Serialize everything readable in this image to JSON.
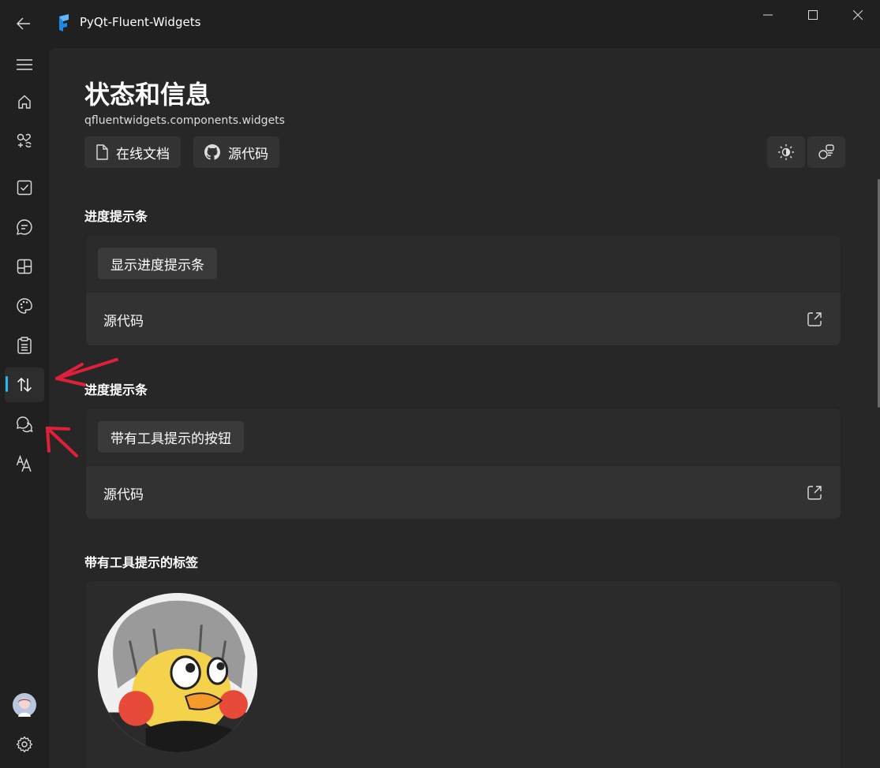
{
  "window": {
    "title": "PyQt-Fluent-Widgets",
    "controls": [
      "minimize-icon",
      "maximize-icon",
      "close-icon"
    ]
  },
  "nav": {
    "items": [
      {
        "name": "menu",
        "icon": "hamburger-icon"
      },
      {
        "name": "home",
        "icon": "home-icon"
      },
      {
        "name": "icons",
        "icon": "shapes-icon"
      },
      {
        "name": "basic-input",
        "icon": "checkbox-icon"
      },
      {
        "name": "dialog-flyout",
        "icon": "chat-bubble-icon"
      },
      {
        "name": "layout",
        "icon": "layout-icon"
      },
      {
        "name": "material",
        "icon": "palette-icon"
      },
      {
        "name": "menu-toolbar",
        "icon": "clipboard-icon"
      },
      {
        "name": "status-info",
        "icon": "arrow-up-down-icon",
        "selected": true
      },
      {
        "name": "text",
        "icon": "chat-help-icon"
      },
      {
        "name": "typography",
        "icon": "font-icon"
      },
      {
        "name": "avatar",
        "icon": "avatar-icon"
      },
      {
        "name": "settings",
        "icon": "gear-icon"
      }
    ],
    "accent": "#29b6f6"
  },
  "page": {
    "title": "状态和信息",
    "subtitle": "qfluentwidgets.components.widgets",
    "doc_button": "在线文档",
    "source_button": "源代码"
  },
  "sections": [
    {
      "title": "进度提示条",
      "button": "显示进度提示条",
      "source_label": "源代码"
    },
    {
      "title": "进度提示条",
      "button": "带有工具提示的按钮",
      "source_label": "源代码"
    },
    {
      "title": "带有工具提示的标签"
    }
  ],
  "colors": {
    "window_bg": "#202020",
    "content_bg": "#272727",
    "card_bg": "#2b2b2b",
    "card_footer_bg": "#323232",
    "annotation_red": "#e0203a"
  }
}
